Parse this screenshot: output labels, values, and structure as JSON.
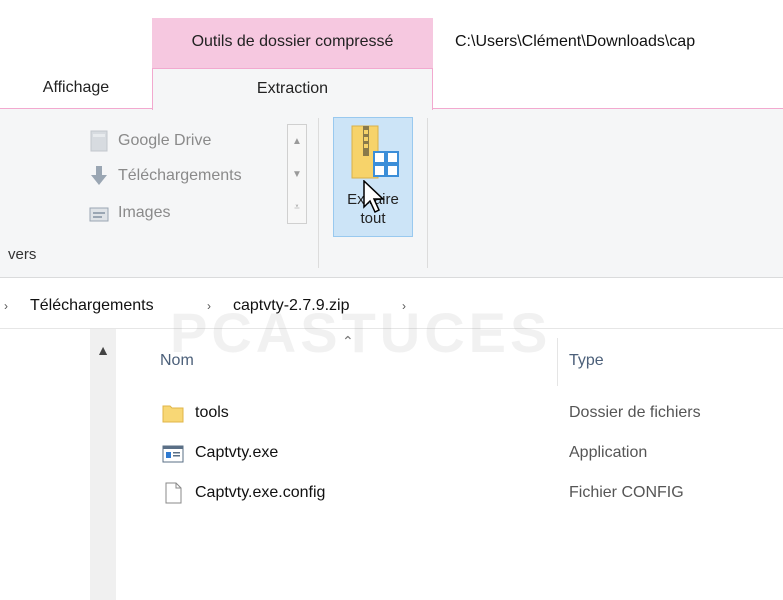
{
  "title_bar": {
    "context_tab_label": "Outils de dossier compressé",
    "path_title": "C:\\Users\\Clément\\Downloads\\cap",
    "context_color": "#f6c8e0"
  },
  "ribbon": {
    "tabs": [
      {
        "label": "Affichage"
      },
      {
        "label": "Extraction"
      }
    ],
    "gallery": {
      "items": [
        {
          "label": "Google Drive",
          "icon": "google-drive-icon"
        },
        {
          "label": "Téléchargements",
          "icon": "download-arrow-icon"
        },
        {
          "label": "Images",
          "icon": "images-icon"
        }
      ]
    },
    "group_label": "vers",
    "extract_all_label_line1": "Extraire",
    "extract_all_label_line2": "tout"
  },
  "address_bar": {
    "crumbs": [
      "Téléchargements",
      "captvty-2.7.9.zip"
    ],
    "separator": "›"
  },
  "file_list": {
    "columns": {
      "name": "Nom",
      "type": "Type"
    },
    "rows": [
      {
        "name": "tools",
        "type": "Dossier de fichiers",
        "icon": "folder-icon"
      },
      {
        "name": "Captvty.exe",
        "type": "Application",
        "icon": "exe-icon"
      },
      {
        "name": "Captvty.exe.config",
        "type": "Fichier CONFIG",
        "icon": "file-icon"
      }
    ]
  },
  "watermark": "PCASTUCES"
}
